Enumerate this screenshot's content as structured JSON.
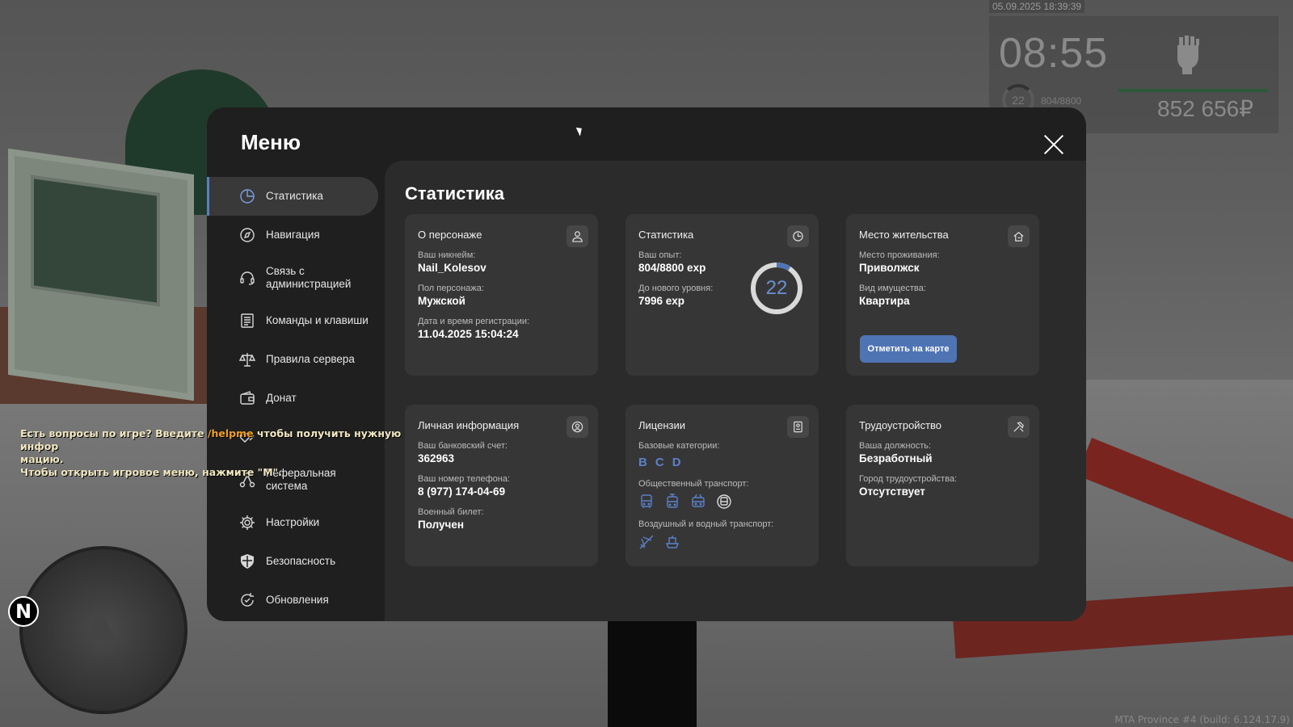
{
  "hud": {
    "datetime": "05.09.2025 18:39:39",
    "time": "08:55",
    "level": "22",
    "exp": "804/8800",
    "money": "852 656₽"
  },
  "chat": {
    "line1_a": "Есть вопросы по игре? Введите ",
    "line1_cmd": "/helpme",
    "line1_b": " чтобы получить нужную инфор",
    "line2": "мацию.",
    "line3": "Чтобы открыть игровое меню, нажмите \"M\"."
  },
  "build": "MTA Province #4 (build: 6.124.17.9)",
  "menu": {
    "title": "Меню",
    "close_icon": "close-icon",
    "sidebar": [
      {
        "label": "Статистика",
        "icon": "pie-chart-icon"
      },
      {
        "label": "Навигация",
        "icon": "compass-icon"
      },
      {
        "label": "Связь с администрацией",
        "icon": "headset-icon"
      },
      {
        "label": "Команды и клавиши",
        "icon": "document-list-icon"
      },
      {
        "label": "Правила сервера",
        "icon": "scales-icon"
      },
      {
        "label": "Донат",
        "icon": "wallet-icon"
      },
      {
        "label": "",
        "icon": "hearts-icon"
      },
      {
        "label": "Реферальная система",
        "icon": "network-icon"
      },
      {
        "label": "Настройки",
        "icon": "gear-icon"
      },
      {
        "label": "Безопасность",
        "icon": "shield-icon"
      },
      {
        "label": "Обновления",
        "icon": "refresh-icon"
      }
    ],
    "active_index": 0
  },
  "content": {
    "title": "Статистика",
    "character": {
      "title": "О персонаже",
      "nick_label": "Ваш никнейм:",
      "nick": "Nail_Kolesov",
      "gender_label": "Пол персонажа:",
      "gender": "Мужской",
      "reg_label": "Дата и время регистрации:",
      "reg": "11.04.2025 15:04:24"
    },
    "stats": {
      "title": "Статистика",
      "exp_label": "Ваш опыт:",
      "exp": "804/8800 exp",
      "next_label": "До нового уровня:",
      "next": "7996 exp",
      "level": "22",
      "progress": 0.091
    },
    "residence": {
      "title": "Место жительства",
      "place_label": "Место проживания:",
      "place": "Приволжск",
      "type_label": "Вид имущества:",
      "type": "Квартира",
      "button": "Отметить на карте"
    },
    "personal": {
      "title": "Личная информация",
      "bank_label": "Ваш банковский счет:",
      "bank": "362963",
      "phone_label": "Ваш номер телефона:",
      "phone": "8 (977) 174-04-69",
      "military_label": "Военный билет:",
      "military": "Получен"
    },
    "licenses": {
      "title": "Лицензии",
      "base_label": "Базовые категории:",
      "base": [
        "B",
        "C",
        "D"
      ],
      "public_label": "Общественный транспорт:",
      "public_icons": [
        "bus-icon",
        "tram-icon",
        "trolleybus-icon",
        "metro-icon"
      ],
      "air_label": "Воздушный и водный транспорт:",
      "air_icons": [
        "plane-icon",
        "boat-icon"
      ]
    },
    "employment": {
      "title": "Трудоустройство",
      "position_label": "Ваша должность:",
      "position": "Безработный",
      "city_label": "Город трудоустройства:",
      "city": "Отсутствует"
    }
  },
  "colors": {
    "accent": "#5b7fc4",
    "window": "#1f1f1f",
    "panel": "#2b2b2b",
    "card": "#363636"
  }
}
